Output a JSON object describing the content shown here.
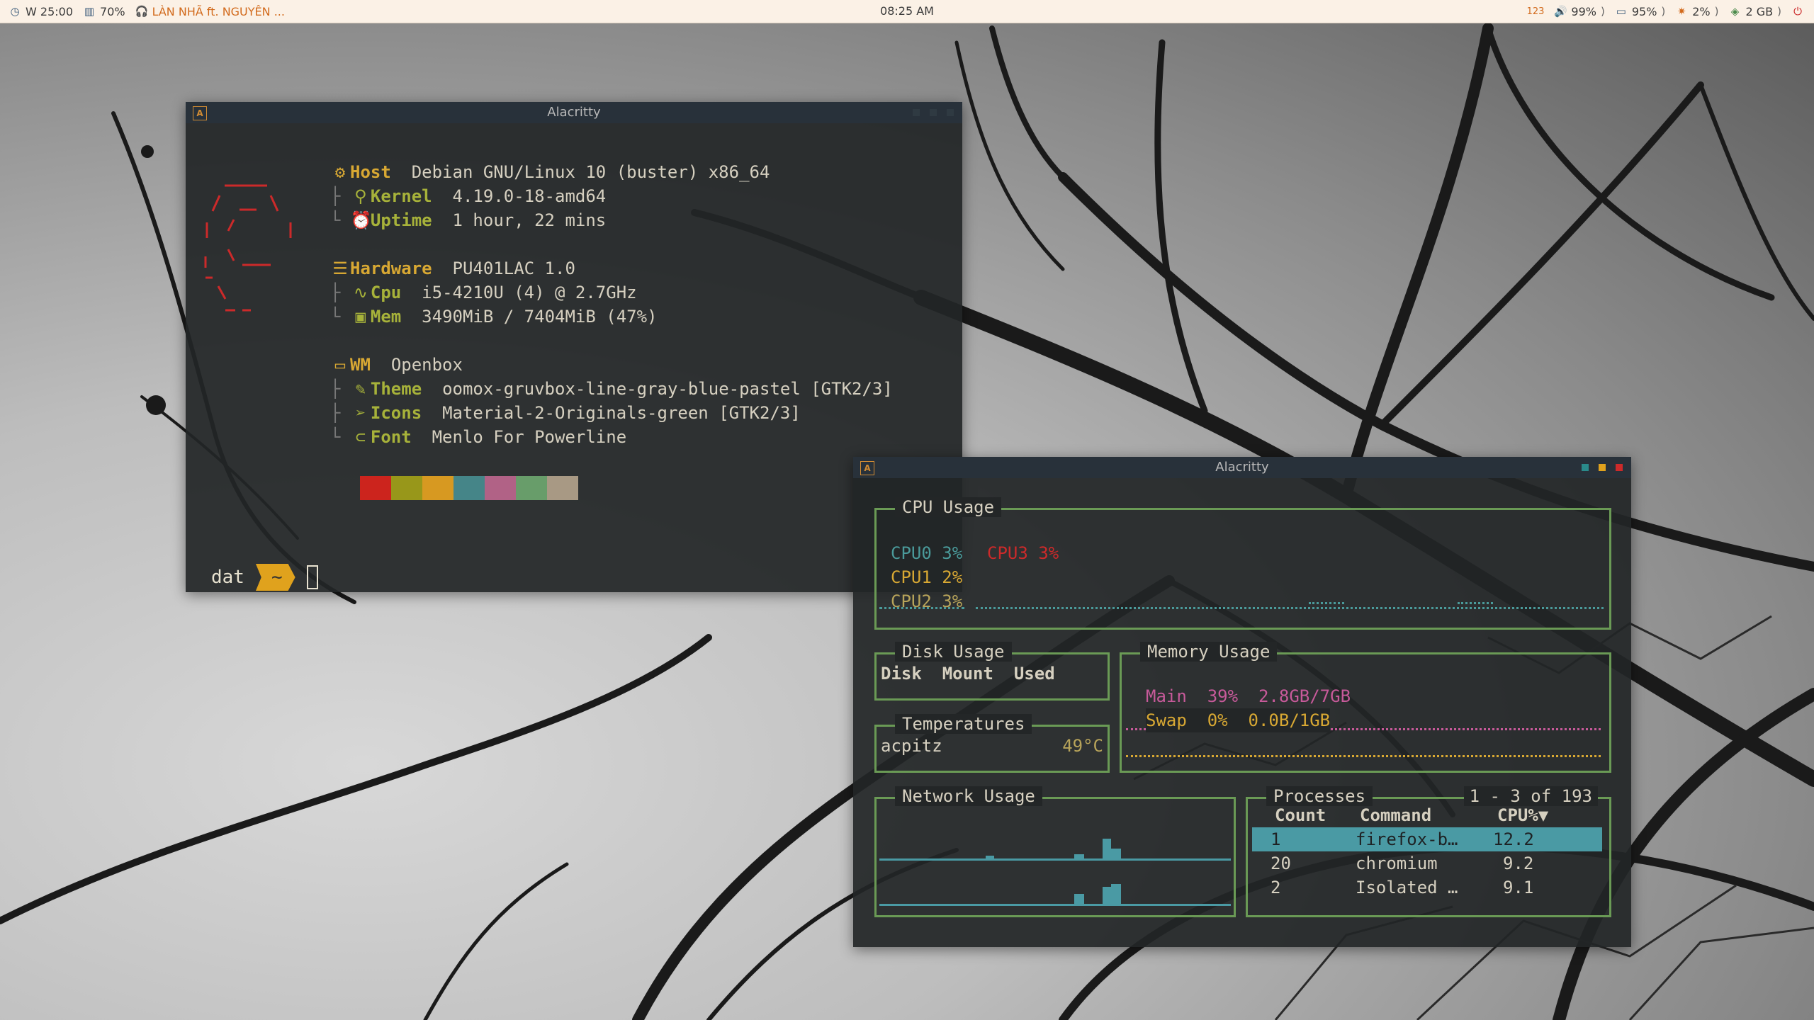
{
  "topbar": {
    "workspace": "W 25:00",
    "volume_left": "70%",
    "music": "LÀN NHÃ ft. NGUYÊN ...",
    "clock": "08:25 AM",
    "updates": "123",
    "volume": "99%",
    "battery": "95%",
    "brightness": "2%",
    "memory": "2 GB",
    "sep": ")"
  },
  "neofetch": {
    "title": "Alacritty",
    "rows": {
      "host_k": "Host",
      "host_v": "Debian GNU/Linux 10 (buster) x86_64",
      "kernel_k": "Kernel",
      "kernel_v": "4.19.0-18-amd64",
      "uptime_k": "Uptime",
      "uptime_v": "1 hour, 22 mins",
      "hardware_k": "Hardware",
      "hardware_v": "PU401LAC 1.0",
      "cpu_k": "Cpu",
      "cpu_v": "i5-4210U (4) @ 2.7GHz",
      "mem_k": "Mem",
      "mem_v": "3490MiB / 7404MiB (47%)",
      "wm_k": "WM",
      "wm_v": "Openbox",
      "theme_k": "Theme",
      "theme_v": "oomox-gruvbox-line-gray-blue-pastel [GTK2/3]",
      "icons_k": "Icons",
      "icons_v": "Material-2-Originals-green [GTK2/3]",
      "font_k": "Font",
      "font_v": "Menlo For Powerline"
    },
    "palette": [
      "#cc241d",
      "#98971a",
      "#d79921",
      "#458588",
      "#b16286",
      "#689d6a",
      "#a89984"
    ],
    "prompt": {
      "user": "dat",
      "dir": "~"
    }
  },
  "bottom": {
    "title": "Alacritty",
    "cpu": {
      "title": "CPU Usage",
      "cpu0": "CPU0",
      "cpu0_v": "3%",
      "cpu1": "CPU1",
      "cpu1_v": "2%",
      "cpu2": "CPU2",
      "cpu2_v": "3%",
      "cpu3": "CPU3",
      "cpu3_v": "3%"
    },
    "disk": {
      "title": "Disk Usage",
      "headers": [
        "Disk",
        "Mount",
        "Used"
      ]
    },
    "memory": {
      "title": "Memory Usage",
      "main_label": "Main",
      "main_pct": "39%",
      "main_val": "2.8GB/7GB",
      "swap_label": "Swap",
      "swap_pct": "0%",
      "swap_val": "0.0B/1GB"
    },
    "temps": {
      "title": "Temperatures",
      "sensor": "acpitz",
      "value": "49°C"
    },
    "network": {
      "title": "Network Usage"
    },
    "processes": {
      "title": "Processes",
      "range": "1 - 3 of 193",
      "headers": [
        "Count",
        "Command",
        "CPU%▼"
      ],
      "rows": [
        {
          "count": "1",
          "command": "firefox-b…",
          "cpu": "12.2"
        },
        {
          "count": "20",
          "command": "chromium",
          "cpu": "9.2"
        },
        {
          "count": "2",
          "command": "Isolated …",
          "cpu": "9.1"
        }
      ]
    }
  },
  "colors": {
    "accent_teal": "#4a9aa4",
    "border_green": "#6a9a55",
    "yellow": "#d8a833",
    "btn_teal": "#2a8a8a",
    "btn_yellow": "#e0a21d",
    "btn_red": "#cc2a2a"
  }
}
